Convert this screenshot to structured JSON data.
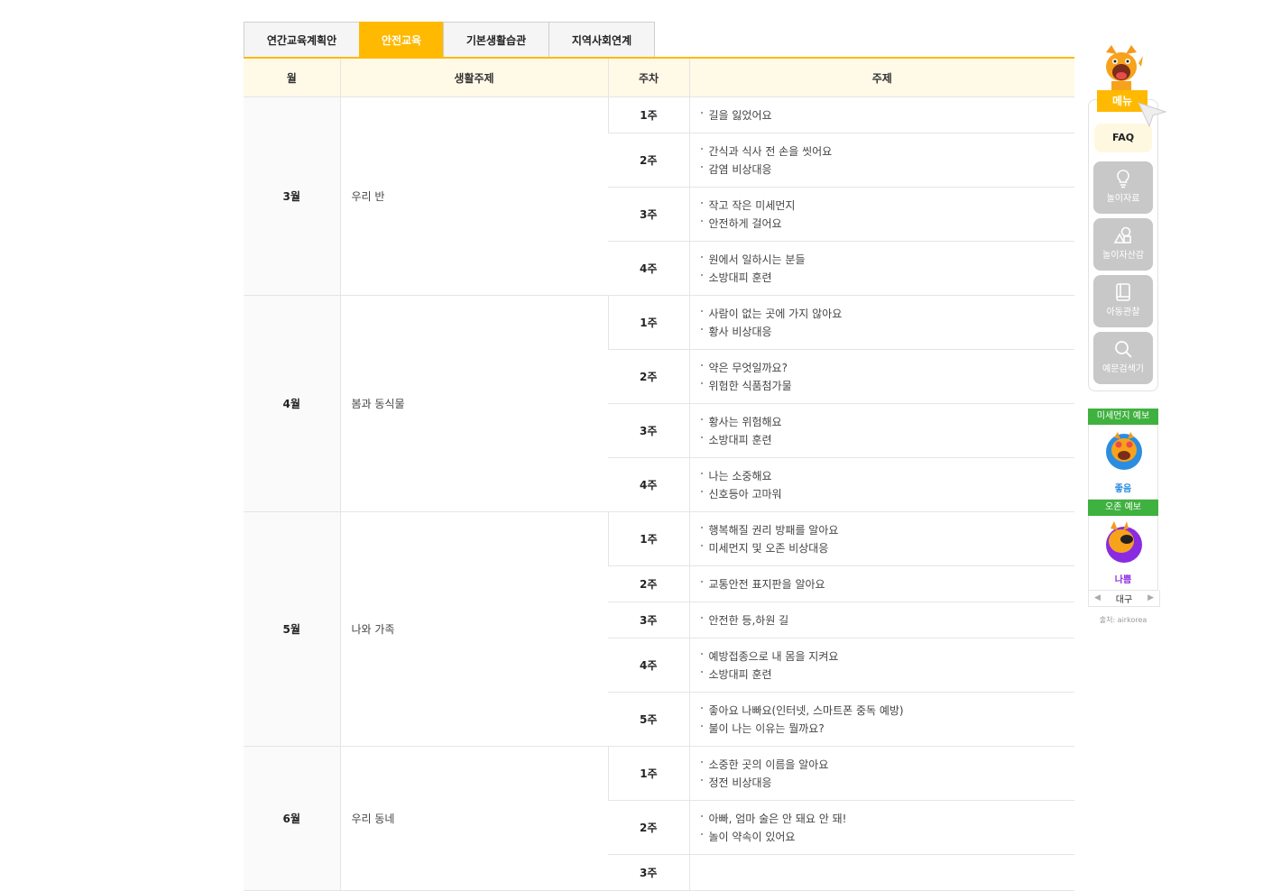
{
  "tabs": [
    {
      "label": "연간교육계획안",
      "active": false
    },
    {
      "label": "안전교육",
      "active": true
    },
    {
      "label": "기본생활습관",
      "active": false
    },
    {
      "label": "지역사회연계",
      "active": false
    }
  ],
  "table": {
    "headers": {
      "month": "월",
      "theme": "생활주제",
      "week": "주차",
      "topic": "주제"
    },
    "rows": [
      {
        "month": "3월",
        "theme": "우리 반",
        "weeks": [
          {
            "week": "1주",
            "topics": [
              "길을 잃었어요"
            ]
          },
          {
            "week": "2주",
            "topics": [
              "간식과 식사 전 손을 씻어요",
              "감염 비상대응"
            ]
          },
          {
            "week": "3주",
            "topics": [
              "작고 작은 미세먼지",
              "안전하게 걸어요"
            ]
          },
          {
            "week": "4주",
            "topics": [
              "원에서 일하시는 분들",
              "소방대피 훈련"
            ]
          }
        ]
      },
      {
        "month": "4월",
        "theme": "봄과 동식물",
        "weeks": [
          {
            "week": "1주",
            "topics": [
              "사람이 없는 곳에 가지 않아요",
              "황사 비상대응"
            ]
          },
          {
            "week": "2주",
            "topics": [
              "약은 무엇일까요?",
              "위험한 식품첨가물"
            ]
          },
          {
            "week": "3주",
            "topics": [
              "황사는 위험해요",
              "소방대피 훈련"
            ]
          },
          {
            "week": "4주",
            "topics": [
              "나는 소중해요",
              "신호등아 고마워"
            ]
          }
        ]
      },
      {
        "month": "5월",
        "theme": "나와 가족",
        "weeks": [
          {
            "week": "1주",
            "topics": [
              "행복해질 권리 방패를 알아요",
              "미세먼지 및 오존 비상대응"
            ]
          },
          {
            "week": "2주",
            "topics": [
              "교통안전 표지판을 알아요"
            ]
          },
          {
            "week": "3주",
            "topics": [
              "안전한 등,하원 길"
            ]
          },
          {
            "week": "4주",
            "topics": [
              "예방접종으로 내 몸을 지켜요",
              "소방대피 훈련"
            ]
          },
          {
            "week": "5주",
            "topics": [
              "좋아요 나빠요(인터넷, 스마트폰 중독 예방)",
              "불이 나는 이유는 뭘까요?"
            ]
          }
        ]
      },
      {
        "month": "6월",
        "theme": "우리 동네",
        "weeks": [
          {
            "week": "1주",
            "topics": [
              "소중한 곳의 이름을 알아요",
              "정전 비상대응"
            ]
          },
          {
            "week": "2주",
            "topics": [
              "아빠, 엄마 술은 안 돼요 안 돼!",
              "놀이 약속이 있어요"
            ]
          },
          {
            "week": "3주",
            "topics": [
              ""
            ]
          }
        ]
      }
    ]
  },
  "side_menu": {
    "title": "메뉴",
    "faq": "FAQ",
    "items": [
      {
        "label": "놀이자료",
        "icon": "lightbulb-icon"
      },
      {
        "label": "놀이자산감",
        "icon": "shapes-icon"
      },
      {
        "label": "아동관찰",
        "icon": "book-icon"
      },
      {
        "label": "예문검색기",
        "icon": "search-icon"
      }
    ]
  },
  "forecast": {
    "dust": {
      "title": "미세먼지 예보",
      "status": "좋음",
      "color": "#2a8de0"
    },
    "ozone": {
      "title": "오존 예보",
      "status": "나쁨",
      "color": "#8a2be2"
    },
    "region": "대구",
    "prev": "◀",
    "next": "▶",
    "source": "출처: airkorea"
  }
}
